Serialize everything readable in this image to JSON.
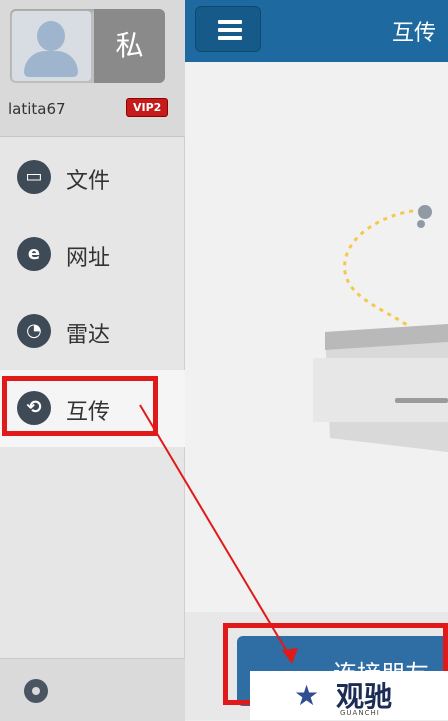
{
  "sidebar": {
    "private_label": "私",
    "username": "latita67",
    "vip_badge": "VIP2",
    "items": [
      {
        "label": "文件",
        "icon": "folder-icon"
      },
      {
        "label": "网址",
        "icon": "browser-e-icon"
      },
      {
        "label": "雷达",
        "icon": "radar-icon"
      },
      {
        "label": "互传",
        "icon": "transfer-icon"
      }
    ],
    "footer_icon": "gear-icon"
  },
  "main": {
    "title": "互传",
    "connect_button": "连接朋友"
  },
  "watermark": {
    "text": "观驰",
    "sub": "GUANCHI"
  },
  "colors": {
    "topbar": "#1e6aa0",
    "accent_red": "#e01a1a",
    "button_blue": "#2f6da5"
  }
}
